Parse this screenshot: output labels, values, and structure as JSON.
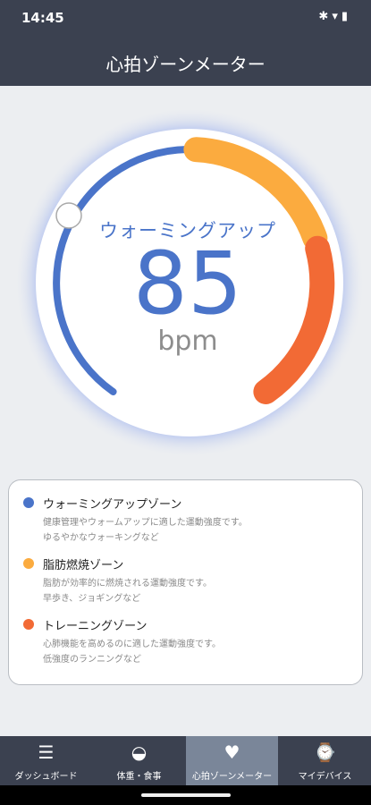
{
  "status_bar": {
    "time": "14:45",
    "icons": [
      "bluetooth-icon",
      "wifi-icon",
      "battery-icon"
    ]
  },
  "app_bar": {
    "title": "心拍ゾーンメーター"
  },
  "gauge": {
    "zone_label": "ウォーミングアップ",
    "bpm": "85",
    "unit": "bpm",
    "colors": {
      "warmup": "#4a74c9",
      "fatburn": "#fbab3f",
      "training": "#f26a35",
      "glow": "#7b95e2"
    }
  },
  "legend": [
    {
      "title": "ウォーミングアップゾーン",
      "desc1": "健康管理やウォームアップに適した運動強度です。",
      "desc2": "ゆるやかなウォーキングなど",
      "color": "#4a74c9"
    },
    {
      "title": "脂肪燃焼ゾーン",
      "desc1": "脂肪が効率的に燃焼される運動強度です。",
      "desc2": "早歩き、ジョギングなど",
      "color": "#fbab3f"
    },
    {
      "title": "トレーニングゾーン",
      "desc1": "心肺機能を高めるのに適した運動強度です。",
      "desc2": "低強度のランニングなど",
      "color": "#f26a35"
    }
  ],
  "bottom_nav": [
    {
      "label": "ダッシュボード",
      "icon": "bar-list-icon",
      "active": false
    },
    {
      "label": "体重・食事",
      "icon": "scale-icon",
      "active": false
    },
    {
      "label": "心拍ゾーンメーター",
      "icon": "heart-icon",
      "active": true
    },
    {
      "label": "マイデバイス",
      "icon": "watch-icon",
      "active": false
    }
  ]
}
